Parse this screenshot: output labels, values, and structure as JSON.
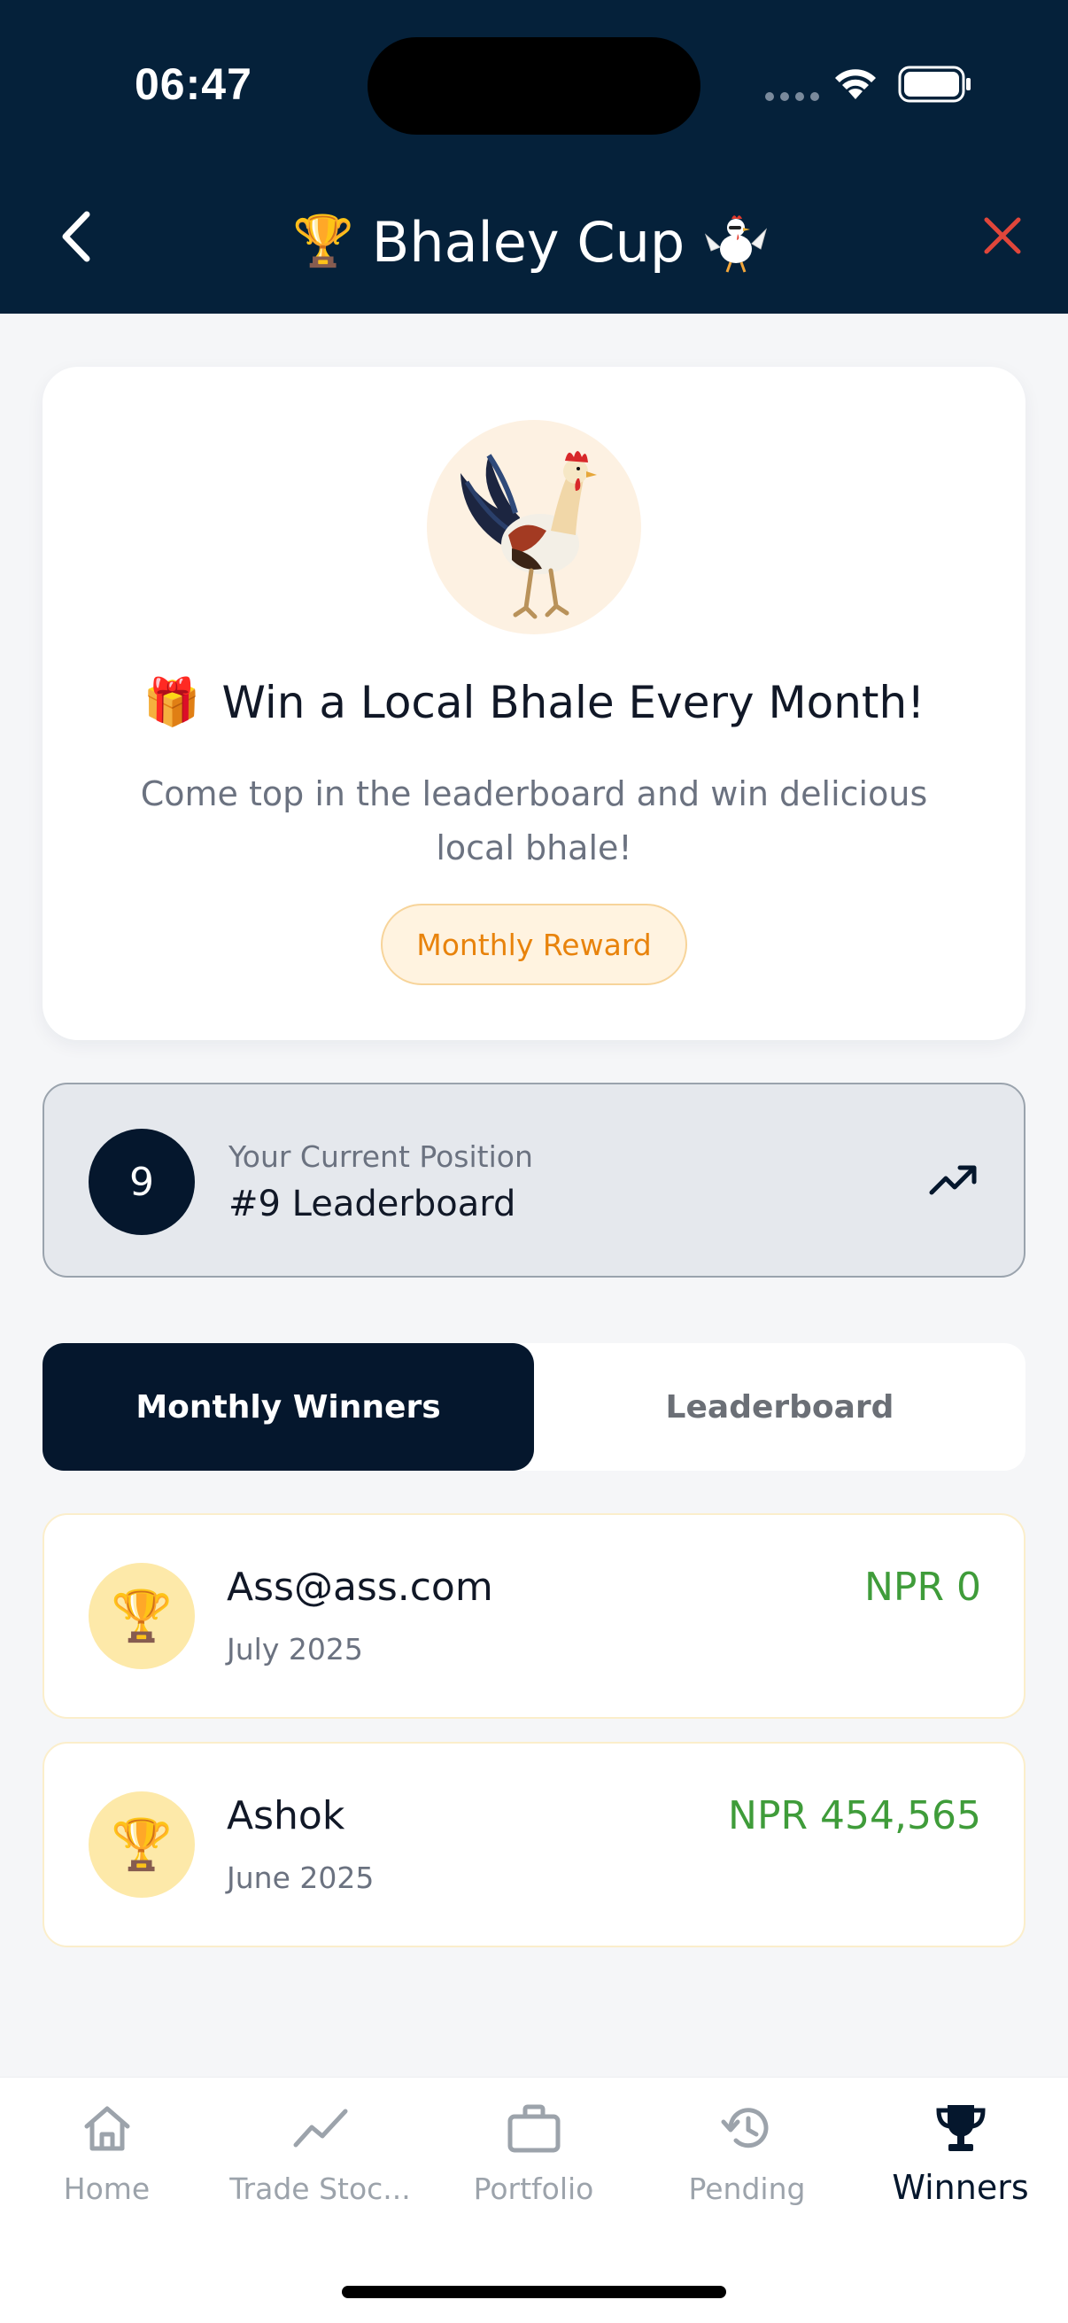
{
  "status_bar": {
    "time": "06:47"
  },
  "header": {
    "title": "Bhaley Cup",
    "trophy_emoji": "🏆",
    "back_icon": "chevron-left-icon",
    "close_icon": "close-icon",
    "close_color": "#e0463a"
  },
  "hero": {
    "gift_emoji": "🎁",
    "title": "Win a Local Bhale Every Month!",
    "subtitle": "Come top in the leaderboard and win delicious local bhale!",
    "reward_label": "Monthly Reward"
  },
  "position": {
    "rank": "9",
    "label": "Your Current Position",
    "value": "#9 Leaderboard"
  },
  "tabs": [
    {
      "label": "Monthly Winners",
      "active": true
    },
    {
      "label": "Leaderboard",
      "active": false
    }
  ],
  "winners": [
    {
      "name": "Ass@ass.com",
      "date": "July 2025",
      "amount": "NPR 0",
      "trophy": "🏆"
    },
    {
      "name": "Ashok",
      "date": "June 2025",
      "amount": "NPR 454,565",
      "trophy": "🏆"
    }
  ],
  "bottom_nav": [
    {
      "label": "Home",
      "icon": "home-icon",
      "active": false
    },
    {
      "label": "Trade Stoc...",
      "icon": "trend-icon",
      "active": false
    },
    {
      "label": "Portfolio",
      "icon": "briefcase-icon",
      "active": false
    },
    {
      "label": "Pending",
      "icon": "history-icon",
      "active": false
    },
    {
      "label": "Winners",
      "icon": "trophy-icon",
      "active": true
    }
  ],
  "colors": {
    "header_bg": "#05213a",
    "active_tab": "#05172d",
    "amount_green": "#3f9c3a",
    "reward_orange": "#e8830c"
  }
}
